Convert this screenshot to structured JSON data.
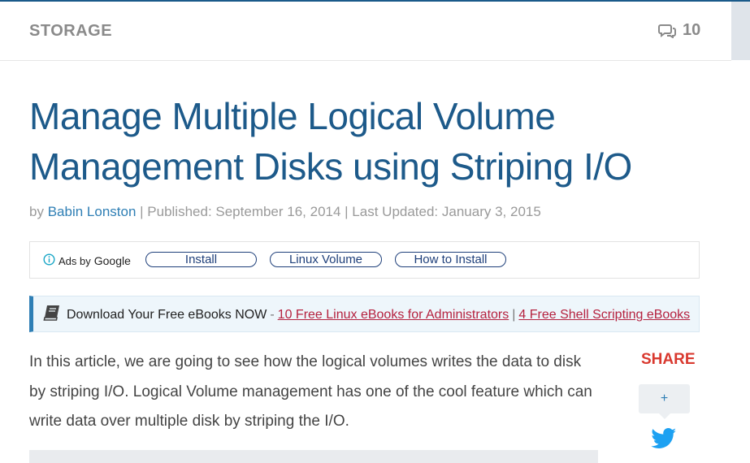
{
  "header": {
    "category": "STORAGE",
    "comment_count": "10",
    "comment_icon": "comments-icon"
  },
  "article": {
    "title": "Manage Multiple Logical Volume Management Disks using Striping I/O",
    "byline": {
      "by": "by",
      "author": "Babin Lonston",
      "published": "| Published: September 16, 2014 | Last Updated: January 3, 2015"
    },
    "intro": "In this article, we are going to see how the logical volumes writes the data to disk by striping I/O. Logical Volume management has one of the cool feature which can write data over multiple disk by striping the I/O."
  },
  "ads": {
    "info_icon": "info-icon",
    "label_prefix": "Ads by",
    "label_brand": "Google",
    "buttons": [
      "Install",
      "Linux Volume",
      "How to Install"
    ]
  },
  "ebook_banner": {
    "icon": "book-icon",
    "lead": "Download Your Free eBooks NOW",
    "dash": "-",
    "link1": "10 Free Linux eBooks for Administrators",
    "separator": "|",
    "link2": "4 Free Shell Scripting eBooks"
  },
  "share": {
    "label": "SHARE",
    "more": "+",
    "twitter_icon": "twitter-icon"
  },
  "colors": {
    "title": "#1d5a8a",
    "link": "#b5223f",
    "share": "#d9392f",
    "accent": "#2f7fb5"
  }
}
